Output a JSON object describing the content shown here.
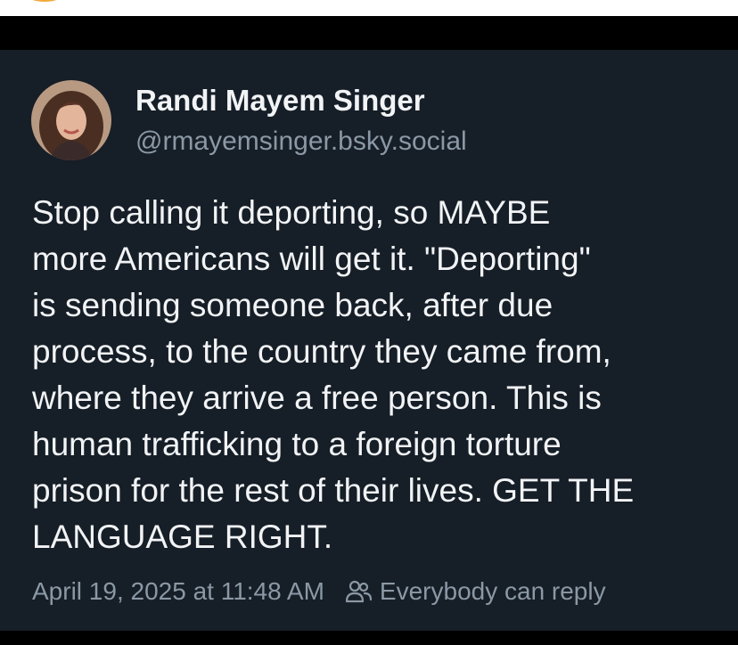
{
  "post": {
    "author_name": "Randi Mayem Singer",
    "author_handle": "@rmayemsinger.bsky.social",
    "text_lines": [
      "Stop calling it deporting, so MAYBE",
      "more Americans will get it. \"Deporting\"",
      "is sending someone back, after due",
      "process, to the country they came from,",
      "where they arrive a free person. This is",
      "human trafficking to a foreign torture",
      "prison for the rest of their lives. GET THE",
      "LANGUAGE RIGHT."
    ],
    "timestamp": "April 19, 2025 at 11:48 AM",
    "reply_setting": "Everybody can reply"
  },
  "icons": {
    "avatar": "avatar",
    "reply_setting_icon": "people-icon"
  },
  "colors": {
    "card_background": "#161e27",
    "primary_text": "#f1f3f5",
    "secondary_text": "#8b98a5",
    "page_background": "#000000"
  }
}
